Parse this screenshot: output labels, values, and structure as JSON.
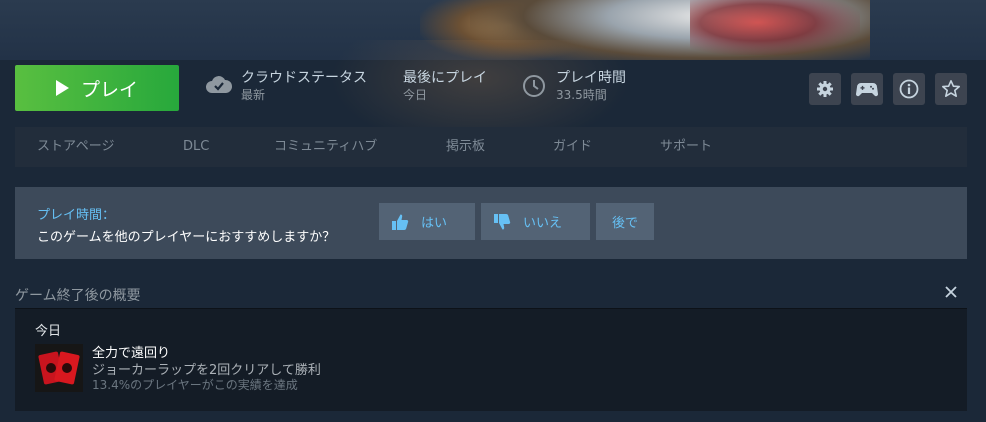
{
  "actions": {
    "play_label": "プレイ",
    "cloud_title": "クラウドステータス",
    "cloud_value": "最新",
    "last_played_title": "最後にプレイ",
    "last_played_value": "今日",
    "playtime_title": "プレイ時間",
    "playtime_value": "33.5時間",
    "icons": [
      "gear-icon",
      "controller-icon",
      "info-icon",
      "star-icon"
    ]
  },
  "nav": {
    "items": [
      "ストアページ",
      "DLC",
      "コミュニティハブ",
      "掲示板",
      "ガイド",
      "サポート"
    ]
  },
  "review": {
    "line1": "プレイ時間：",
    "line2": "このゲームを他のプレイヤーにおすすめしますか？",
    "yes_label": "はい",
    "no_label": "いいえ",
    "later_label": "後で"
  },
  "summary": {
    "title": "ゲーム終了後の概要",
    "date_label": "今日",
    "achievement": {
      "name": "全力で遠回り",
      "description": "ジョーカーラップを2回クリアして勝利",
      "percent_text": "13.4%のプレイヤーがこの実績を達成"
    }
  },
  "colors": {
    "accent": "#66c0f4",
    "play_green": "#59bf40",
    "background": "#1b2838"
  }
}
